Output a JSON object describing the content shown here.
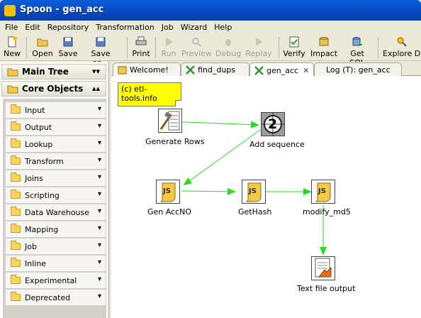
{
  "window": {
    "title": "Spoon - gen_acc"
  },
  "menu": [
    "File",
    "Edit",
    "Repository",
    "Transformation",
    "Job",
    "Wizard",
    "Help"
  ],
  "toolbar": {
    "new": "New",
    "open": "Open",
    "save": "Save",
    "save_as": "Save as...",
    "print": "Print",
    "run": "Run",
    "preview": "Preview",
    "debug": "Debug",
    "replay": "Replay",
    "verify": "Verify",
    "impact": "Impact",
    "get_sql": "Get SQL",
    "explore_db": "Explore DB"
  },
  "left": {
    "main_tree": "Main Tree",
    "core_objects": "Core Objects",
    "categories": [
      "Input",
      "Output",
      "Lookup",
      "Transform",
      "Joins",
      "Scripting",
      "Data Warehouse",
      "Mapping",
      "Job",
      "Inline",
      "Experimental",
      "Deprecated"
    ]
  },
  "tabs": [
    {
      "label": "Welcome!"
    },
    {
      "label": "find_dups"
    },
    {
      "label": "gen_acc",
      "active": true
    },
    {
      "label": "Log (T): gen_acc"
    }
  ],
  "canvas": {
    "note": "(c) etl-tools.info",
    "steps": {
      "generate_rows": "Generate Rows",
      "add_sequence": "Add sequence",
      "gen_accno": "Gen AccNO",
      "gethash": "GetHash",
      "modify_md5": "modify_md5",
      "text_file_output": "Text file output"
    },
    "sequence_number": "2"
  },
  "colors": {
    "hop": "#22dd22",
    "note": "#ffff00",
    "titlebar": "#0a5fd8"
  }
}
